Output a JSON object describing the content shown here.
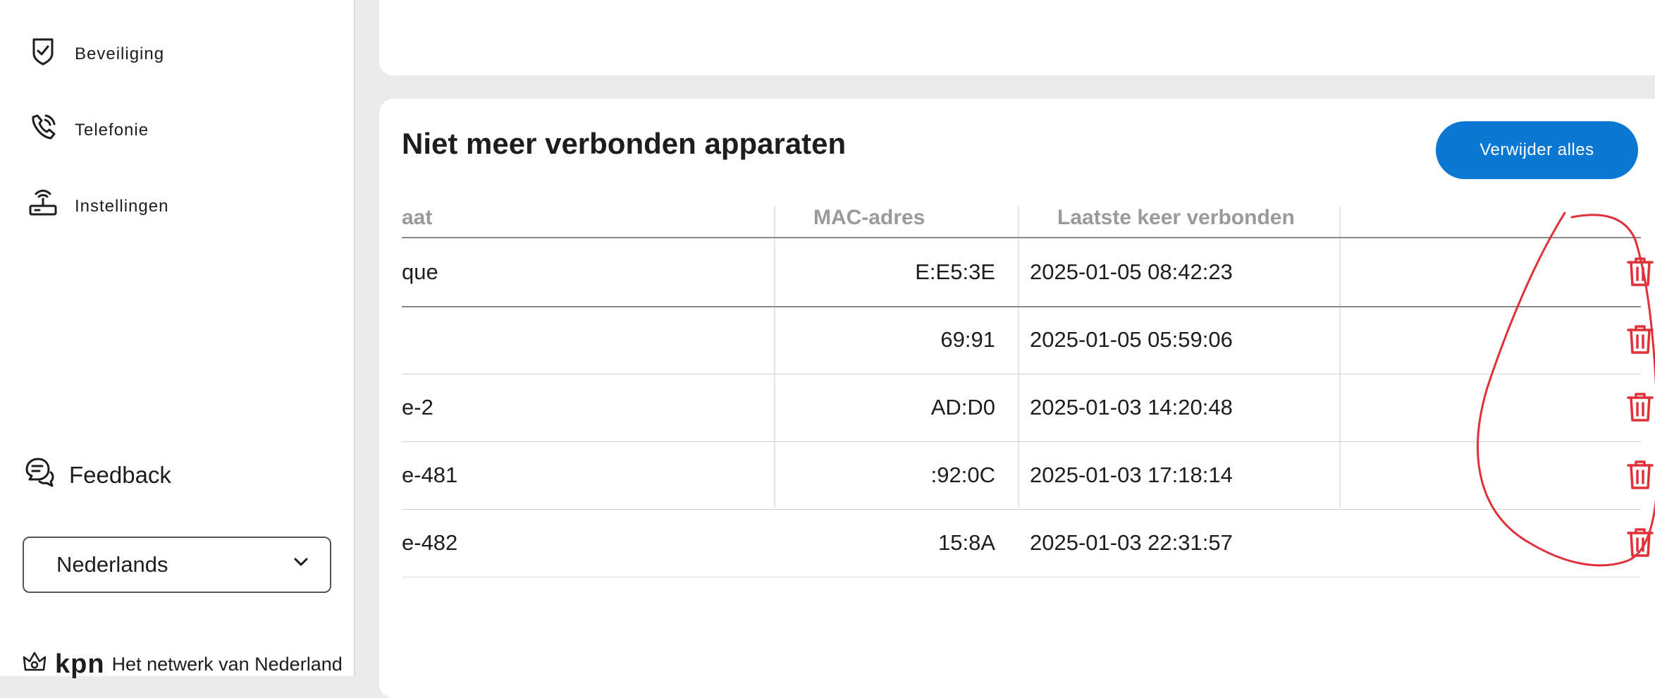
{
  "sidebar": {
    "items": [
      {
        "label": "Beveiliging",
        "icon": "shield-check-icon"
      },
      {
        "label": "Telefonie",
        "icon": "phone-icon"
      },
      {
        "label": "Instellingen",
        "icon": "router-icon"
      }
    ],
    "feedback": {
      "label": "Feedback",
      "icon": "feedback-chat-icon"
    },
    "language": {
      "selected": "Nederlands",
      "icon": "chevron-down-icon"
    },
    "brand": {
      "logo": "kpn",
      "tagline": "Het netwerk van Nederland",
      "icon": "kpn-crown-icon"
    }
  },
  "devices_card": {
    "title": "Niet meer verbonden apparaten",
    "remove_all_label": "Verwijder alles",
    "columns": {
      "name": "aat",
      "mac": "MAC-adres",
      "last_connected": "Laatste keer verbonden"
    },
    "rows": [
      {
        "name": "que",
        "mac": "E:E5:3E",
        "last_connected": "2025-01-05 08:42:23"
      },
      {
        "name": "",
        "mac": "69:91",
        "last_connected": "2025-01-05 05:59:06"
      },
      {
        "name": "e-2",
        "mac": "AD:D0",
        "last_connected": "2025-01-03 14:20:48"
      },
      {
        "name": "e-481",
        "mac": ":92:0C",
        "last_connected": "2025-01-03 17:18:14"
      },
      {
        "name": "e-482",
        "mac": "15:8A",
        "last_connected": "2025-01-03 22:31:57"
      }
    ],
    "delete_icon": "trash-icon"
  },
  "colors": {
    "accent": "#0a78d2",
    "danger": "#e0303a",
    "annotation": "#e0303a"
  }
}
